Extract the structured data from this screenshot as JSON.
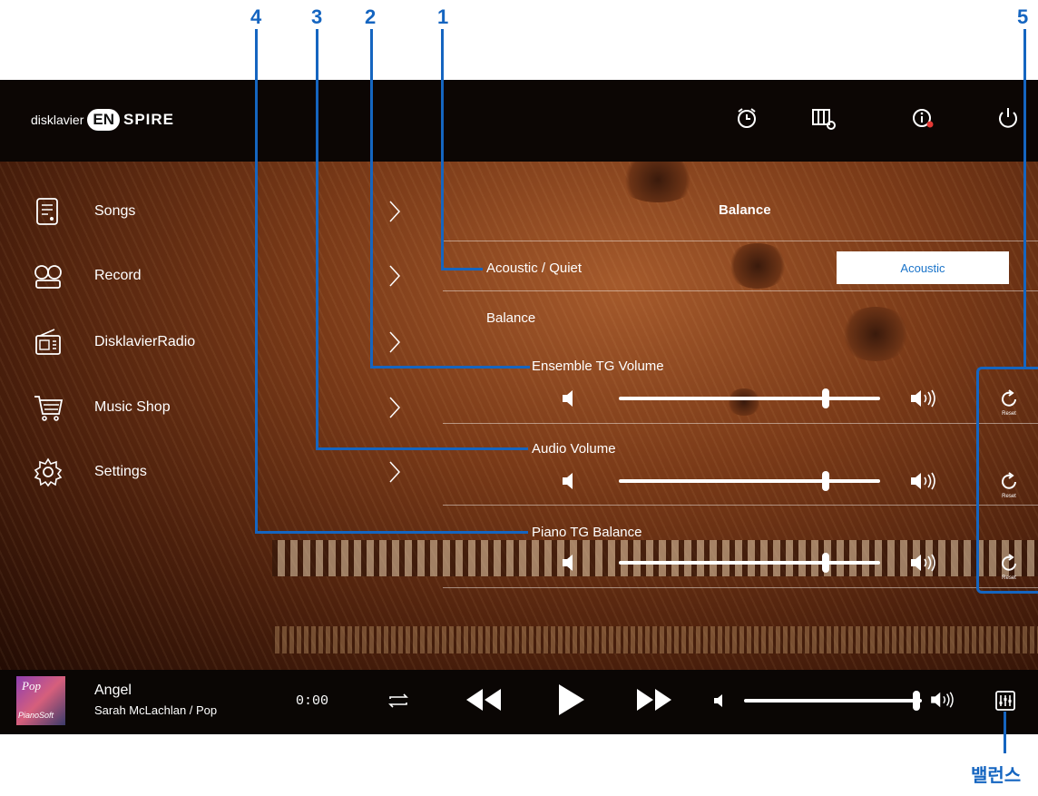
{
  "callouts": {
    "n1": "1",
    "n2": "2",
    "n3": "3",
    "n4": "4",
    "n5": "5",
    "balance_label": "밸런스"
  },
  "brand": {
    "prefix": "disklavier",
    "en": "EN",
    "suffix": "SPIRE"
  },
  "topbar_icons": [
    "alarm-clock-icon",
    "piano-settings-icon",
    "info-icon",
    "power-icon"
  ],
  "sidebar": {
    "items": [
      {
        "label": "Songs",
        "icon": "songs-icon"
      },
      {
        "label": "Record",
        "icon": "record-icon"
      },
      {
        "label": "DisklavierRadio",
        "icon": "radio-icon"
      },
      {
        "label": "Music Shop",
        "icon": "cart-icon"
      },
      {
        "label": "Settings",
        "icon": "gear-icon"
      }
    ]
  },
  "panel": {
    "title": "Balance",
    "acoustic_quiet": {
      "label": "Acoustic / Quiet",
      "value": "Acoustic"
    },
    "balance_section": "Balance",
    "sliders": [
      {
        "label": "Ensemble TG Volume",
        "level": 0.79,
        "reset_label": "Reset"
      },
      {
        "label": "Audio Volume",
        "level": 0.79,
        "reset_label": "Reset"
      },
      {
        "label": "Piano TG Balance",
        "level": 0.79,
        "reset_label": "Reset"
      }
    ]
  },
  "player": {
    "cover_genre": "Pop",
    "cover_brand": "PianoSoft",
    "title": "Angel",
    "subtitle": "Sarah McLachlan / Pop",
    "time": "0:00",
    "volume_level": 0.97
  },
  "colors": {
    "callout": "#1565c0",
    "accent": "#1b74c9"
  }
}
